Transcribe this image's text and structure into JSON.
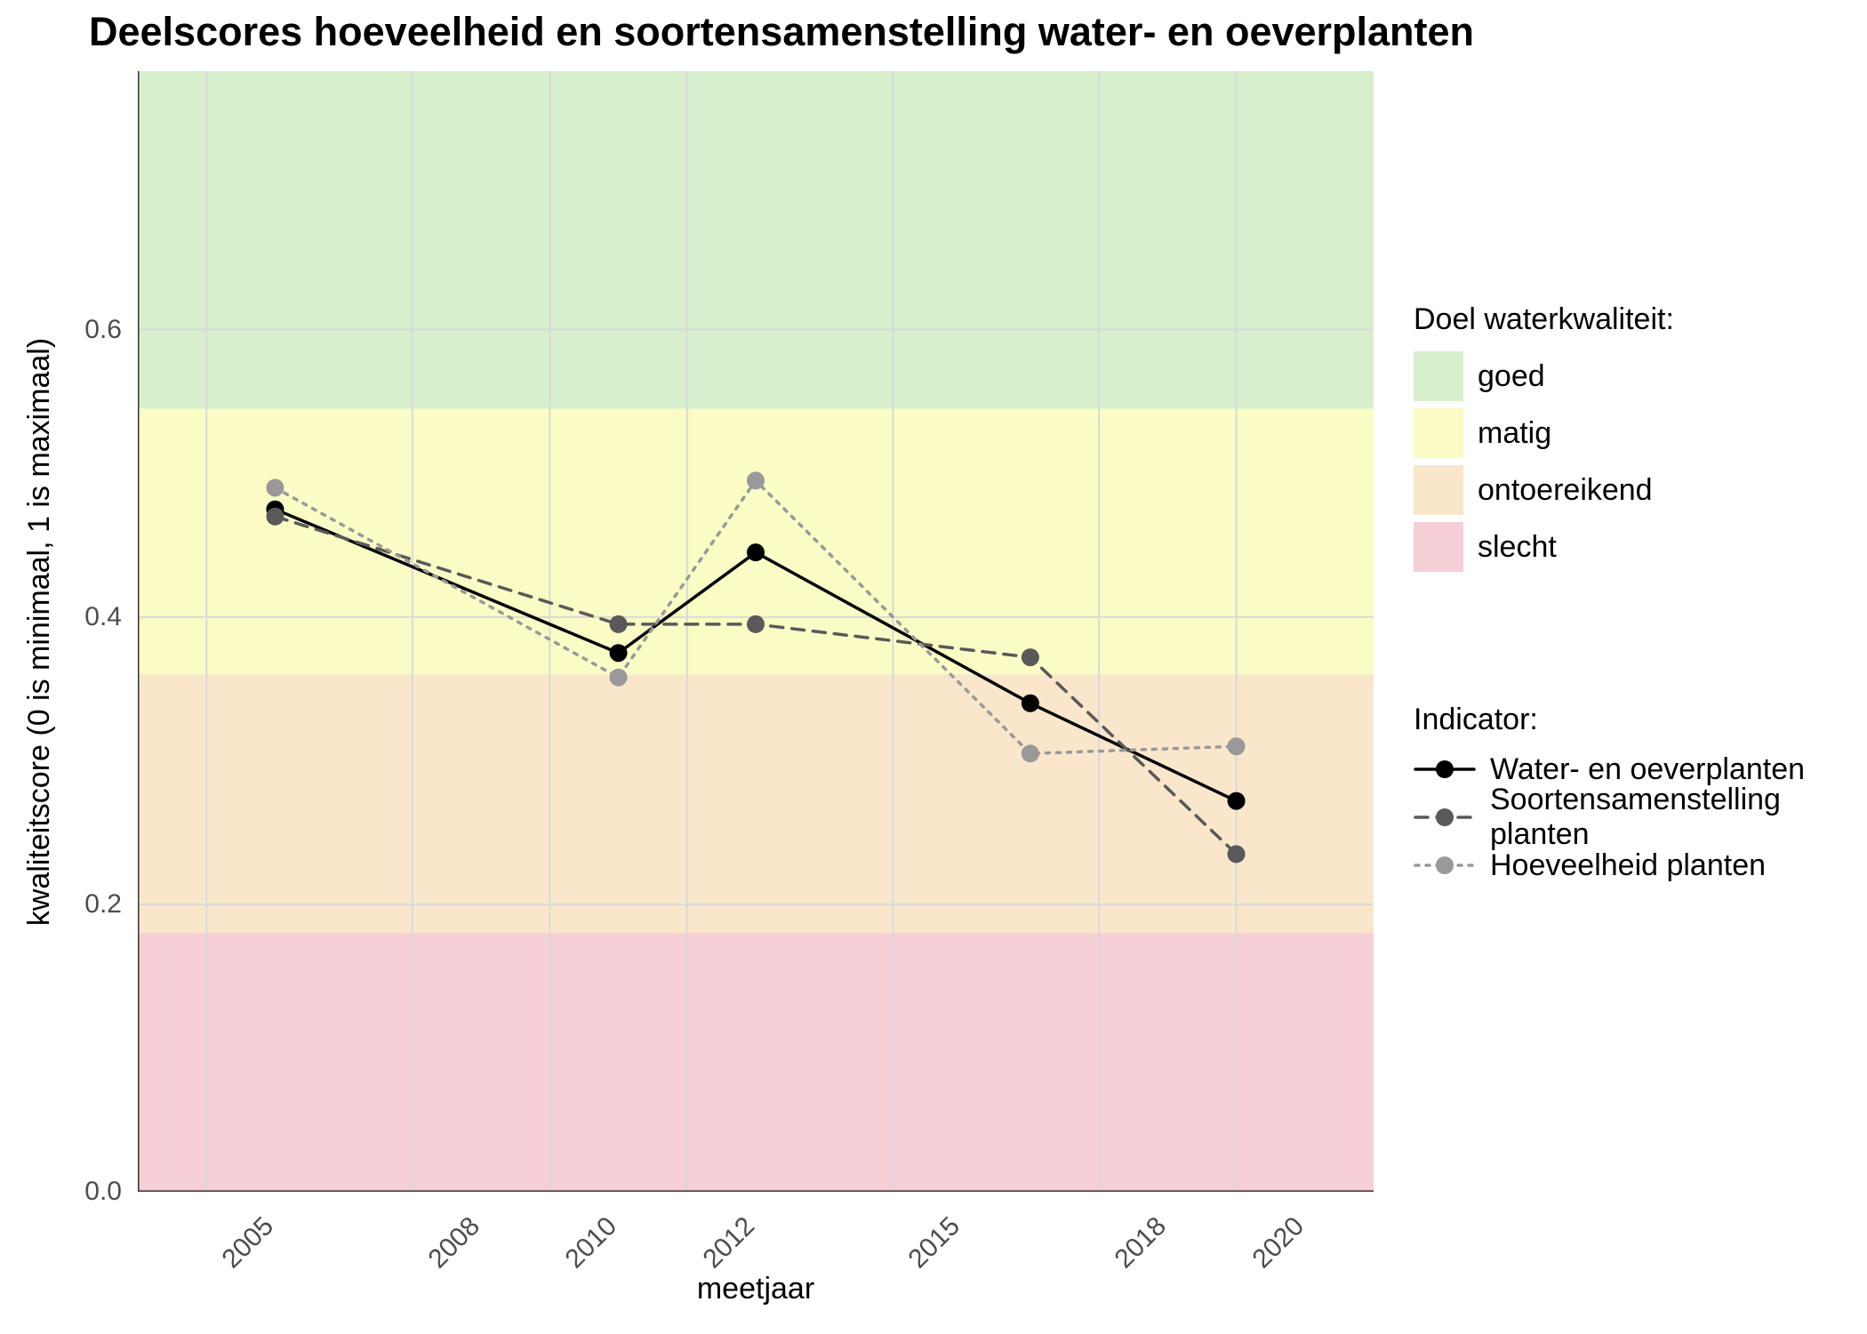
{
  "chart_data": {
    "type": "line",
    "title": "Deelscores hoeveelheid en soortensamenstelling water- en oeverplanten",
    "xlabel": "meetjaar",
    "ylabel": "kwaliteitscore (0 is minimaal, 1 is maximaal)",
    "xlim": [
      2004,
      2022
    ],
    "ylim": [
      0.0,
      0.78
    ],
    "x_ticks": [
      2005,
      2008,
      2010,
      2012,
      2015,
      2018,
      2020
    ],
    "y_ticks": [
      0.0,
      0.2,
      0.4,
      0.6
    ],
    "x": [
      2006,
      2011,
      2013,
      2017,
      2020
    ],
    "series": [
      {
        "name": "Water- en oeverplanten",
        "linetype": "solid",
        "color": "#000000",
        "values": [
          0.475,
          0.375,
          0.445,
          0.34,
          0.272
        ]
      },
      {
        "name": "Soortensamenstelling planten",
        "linetype": "dashed",
        "color": "#595959",
        "values": [
          0.47,
          0.395,
          0.395,
          0.372,
          0.235
        ]
      },
      {
        "name": "Hoeveelheid planten",
        "linetype": "dotted",
        "color": "#999999",
        "values": [
          0.49,
          0.358,
          0.495,
          0.305,
          0.31
        ]
      }
    ],
    "bands_legend_title": "Doel waterkwaliteit:",
    "bands": [
      {
        "name": "goed",
        "from": 0.545,
        "to": 0.78,
        "color": "#d8efce"
      },
      {
        "name": "matig",
        "from": 0.36,
        "to": 0.545,
        "color": "#fbfbc5"
      },
      {
        "name": "ontoereikend",
        "from": 0.18,
        "to": 0.36,
        "color": "#fae6cb"
      },
      {
        "name": "slecht",
        "from": 0.0,
        "to": 0.18,
        "color": "#f6ced6"
      }
    ],
    "indicator_legend_title": "Indicator:"
  }
}
